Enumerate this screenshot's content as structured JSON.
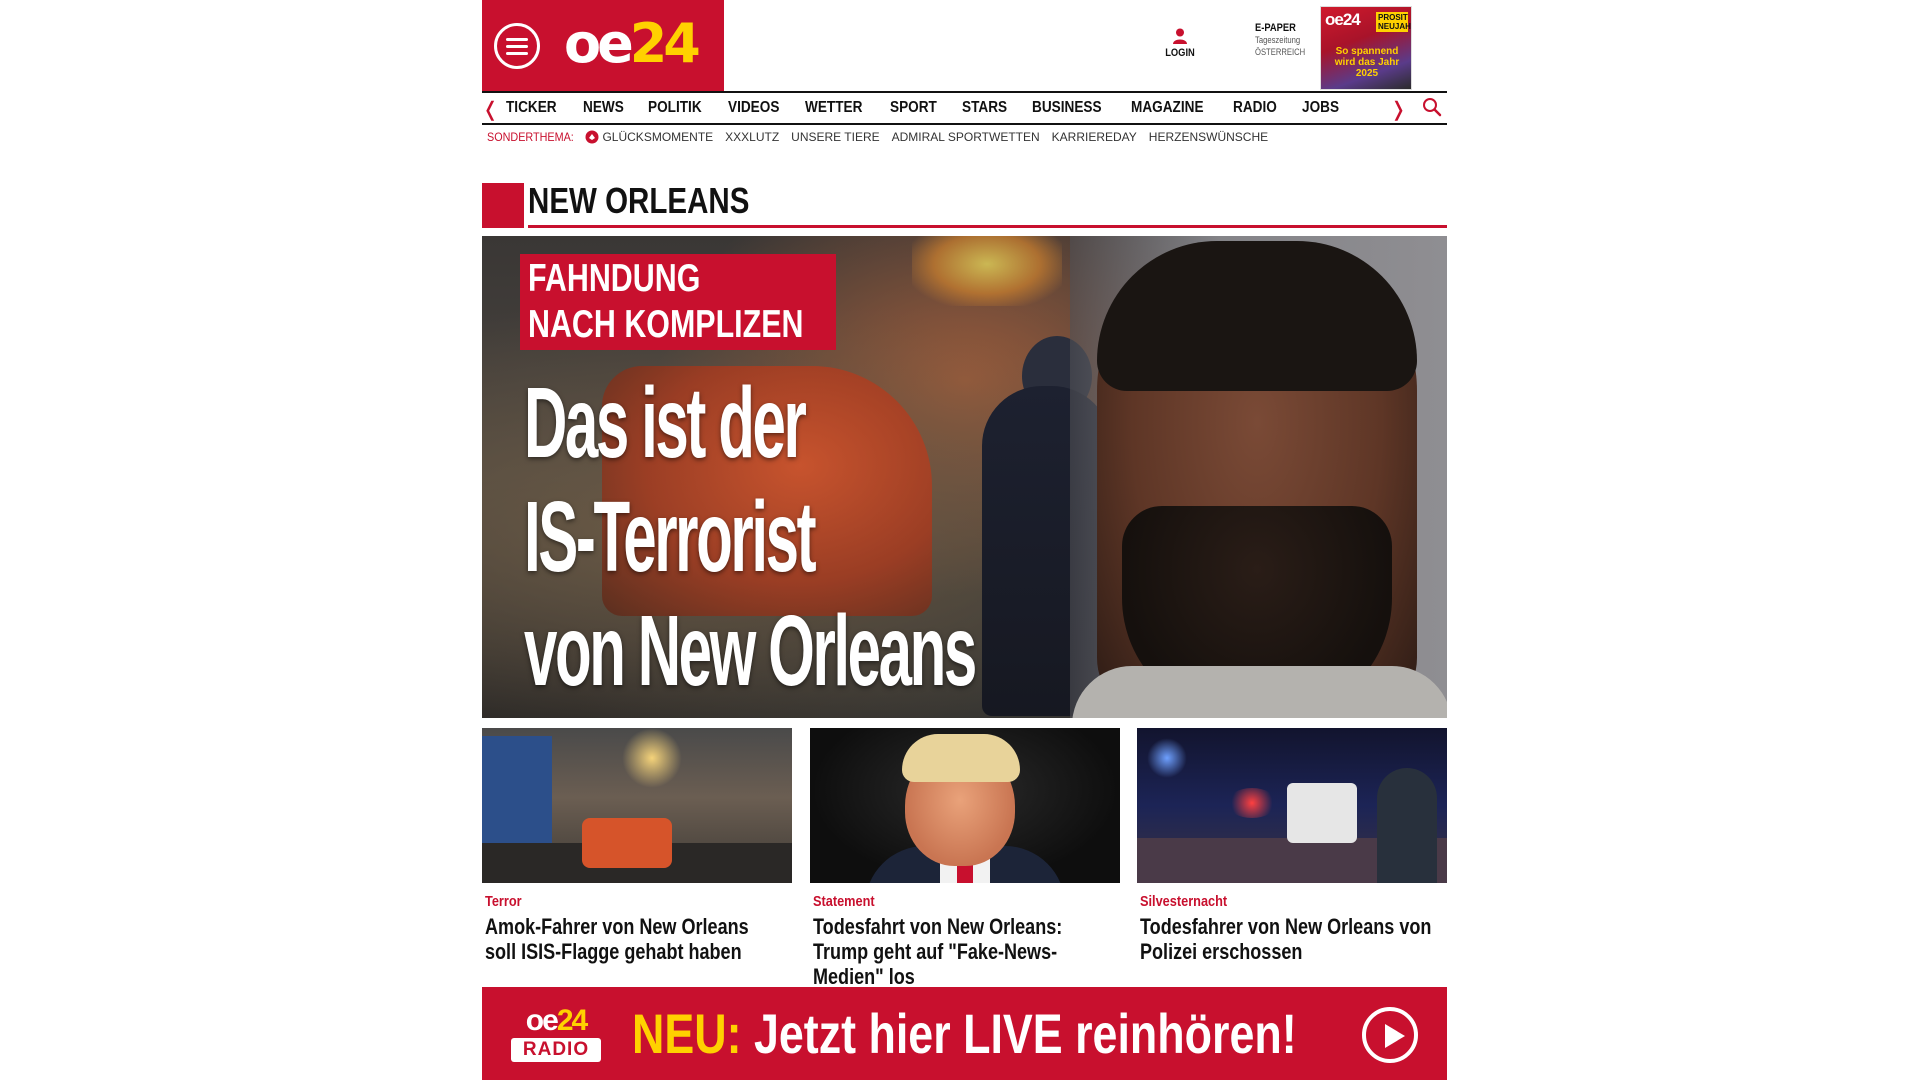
{
  "header": {
    "logo_text_oe": "oe",
    "logo_text_24": "24",
    "login_label": "LOGIN",
    "epaper_title": "E-PAPER",
    "epaper_line1": "Tageszeitung",
    "epaper_line2": "ÖSTERREICH",
    "epaper_cover_logo": "oe24",
    "epaper_cover_badge": "PROSIT NEUJAHR!",
    "epaper_cover_headline": "So spannend wird das Jahr 2025"
  },
  "nav": {
    "items": [
      "TICKER",
      "NEWS",
      "POLITIK",
      "VIDEOS",
      "WETTER",
      "SPORT",
      "STARS",
      "BUSINESS",
      "MAGAZINE",
      "RADIO",
      "JOBS"
    ],
    "left_arrow": "❬",
    "right_arrow": "❭"
  },
  "sub_nav": {
    "label": "SONDERTHEMA:",
    "items": [
      "GLÜCKSMOMENTE",
      "XXXLUTZ",
      "UNSERE TIERE",
      "ADMIRAL SPORTWETTEN",
      "KARRIEREDAY",
      "HERZENSWÜNSCHE"
    ]
  },
  "section": {
    "title": "NEW ORLEANS"
  },
  "hero": {
    "kicker_line1": "FAHNDUNG",
    "kicker_line2": "NACH KOMPLIZEN",
    "headline_line1": "Das ist der",
    "headline_line2": "IS-Terrorist",
    "headline_line3": "von New Orleans"
  },
  "cards": [
    {
      "category": "Terror",
      "title": "Amok-Fahrer von New Orleans soll ISIS-Flagge gehabt haben"
    },
    {
      "category": "Statement",
      "title": "Todesfahrt von New Orleans: Trump geht auf \"Fake-News-Medien\" los"
    },
    {
      "category": "Silvesternacht",
      "title": "Todesfahrer von New Orleans von Polizei erschossen"
    }
  ],
  "radio_banner": {
    "logo_oe": "oe",
    "logo_24": "24",
    "logo_label": "RADIO",
    "neu": "NEU:",
    "text": "Jetzt hier LIVE reinhören!"
  },
  "colors": {
    "brand_red": "#c8102e",
    "brand_yellow": "#ffd100"
  },
  "icons": [
    "menu-icon",
    "user-icon",
    "search-icon",
    "play-icon",
    "chevron-left-icon",
    "chevron-right-icon",
    "sonderthema-icon"
  ]
}
